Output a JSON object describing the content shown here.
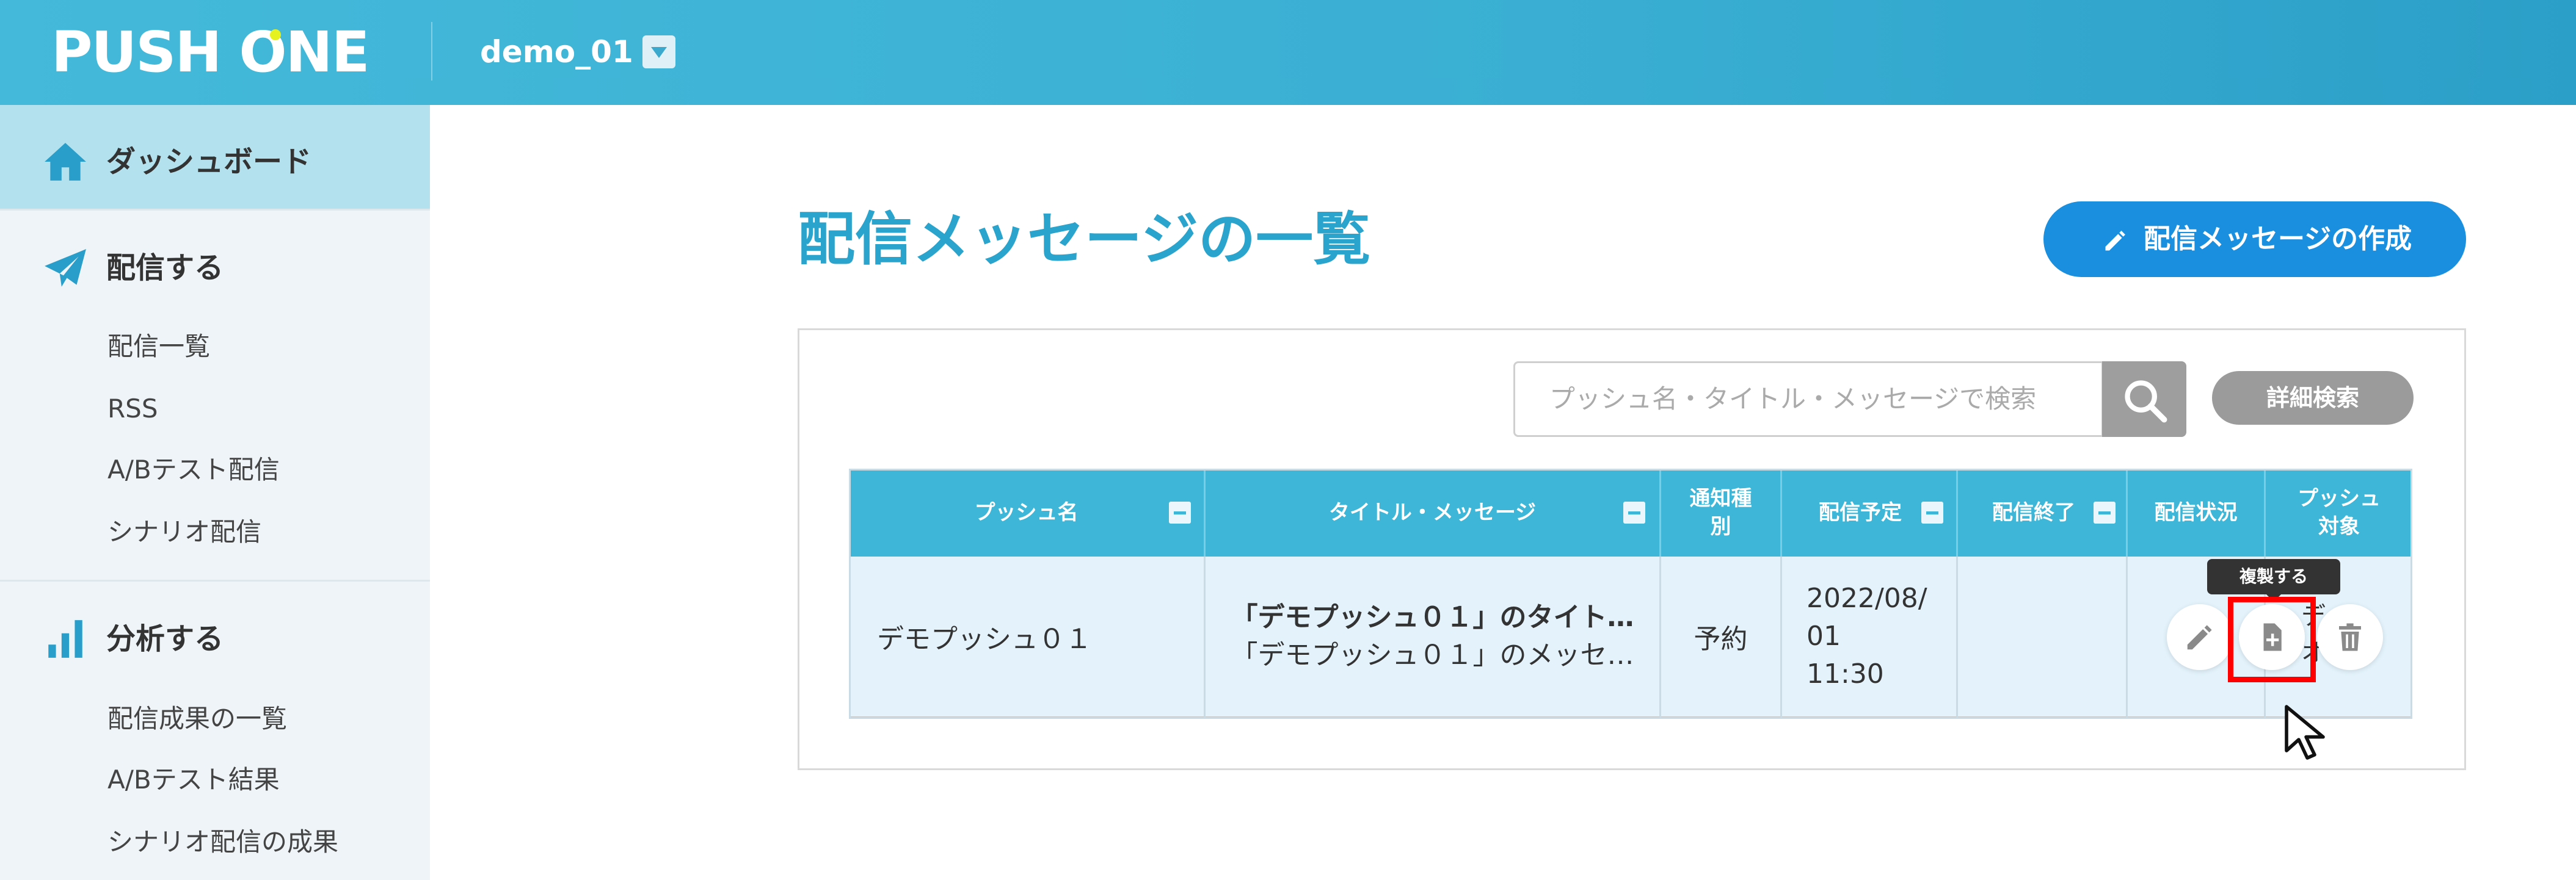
{
  "header": {
    "logo_text_before": "PUSH ",
    "logo_text_o": "O",
    "logo_text_after": "NE",
    "account_name": "demo_01"
  },
  "sidebar": {
    "dashboard": "ダッシュボード",
    "deliver_section": "配信する",
    "deliver_items": [
      "配信一覧",
      "RSS",
      "A/Bテスト配信",
      "シナリオ配信"
    ],
    "analyze_section": "分析する",
    "analyze_items": [
      "配信成果の一覧",
      "A/Bテスト結果",
      "シナリオ配信の成果"
    ]
  },
  "main": {
    "page_title": "配信メッセージの一覧",
    "create_button": "配信メッセージの作成",
    "search_placeholder": "プッシュ名・タイトル・メッセージで検索",
    "advanced_search": "詳細検索"
  },
  "table": {
    "headers": {
      "push_name": "プッシュ名",
      "title_message": "タイトル・メッセージ",
      "notify_type_line1": "通知種",
      "notify_type_line2": "別",
      "scheduled": "配信予定",
      "ended": "配信終了",
      "status": "配信状況",
      "target_line1": "プッシュ",
      "target_line2": "対象"
    },
    "rows": [
      {
        "push_name": "デモプッシュ０１",
        "title": "「デモプッシュ０１」のタイト…",
        "message": "「デモプッシュ０１」のメッセ…",
        "notify_type": "予約",
        "scheduled_line1": "2022/08/",
        "scheduled_line2": "01",
        "scheduled_line3": "11:30",
        "ended": "",
        "target_partial_1": "デ",
        "target_partial_2": "オ"
      }
    ]
  },
  "tooltip": {
    "duplicate": "複製する"
  },
  "colors": {
    "header": "#3aafd3",
    "accent": "#2aa3cd",
    "table_header": "#3db6d8",
    "row_bg": "#e3f2fb",
    "create_button": "#1a8fe0",
    "highlight": "#ff0000"
  }
}
